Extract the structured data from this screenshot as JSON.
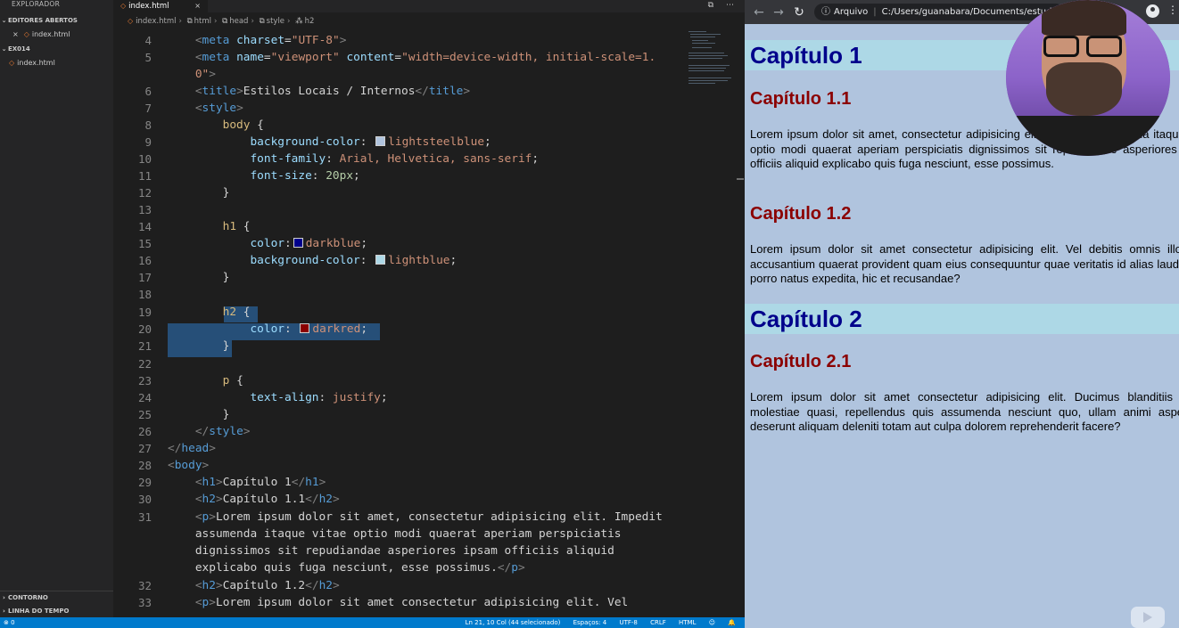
{
  "vscode": {
    "sidebar": {
      "title": "EXPLORADOR",
      "open_editors_label": "EDITORES ABERTOS",
      "open_editor_file": "index.html",
      "folder_label": "EX014",
      "folder_file": "index.html",
      "outline_label": "CONTORNO",
      "timeline_label": "LINHA DO TEMPO"
    },
    "tab": {
      "label": "index.html",
      "close": "×"
    },
    "tab_actions": [
      "⧉",
      "⋯"
    ],
    "breadcrumb": [
      "index.html",
      "html",
      "head",
      "style",
      "h2"
    ],
    "code_lines": [
      {
        "n": "4"
      },
      {
        "n": "5"
      },
      {
        "n": ""
      },
      {
        "n": "6"
      },
      {
        "n": "7"
      },
      {
        "n": "8"
      },
      {
        "n": "9"
      },
      {
        "n": "10"
      },
      {
        "n": "11"
      },
      {
        "n": "12"
      },
      {
        "n": "13"
      },
      {
        "n": "14"
      },
      {
        "n": "15"
      },
      {
        "n": "16"
      },
      {
        "n": "17"
      },
      {
        "n": "18"
      },
      {
        "n": "19"
      },
      {
        "n": "20"
      },
      {
        "n": "21"
      },
      {
        "n": "22"
      },
      {
        "n": "23"
      },
      {
        "n": "24"
      },
      {
        "n": "25"
      },
      {
        "n": "26"
      },
      {
        "n": "27"
      },
      {
        "n": "28"
      },
      {
        "n": "29"
      },
      {
        "n": "30"
      },
      {
        "n": "31"
      },
      {
        "n": ""
      },
      {
        "n": ""
      },
      {
        "n": ""
      },
      {
        "n": "32"
      },
      {
        "n": "33"
      }
    ],
    "code": {
      "meta_charset": "UTF-8",
      "meta_name": "viewport",
      "meta_content_1": "width=device-width, initial-scale=1.",
      "meta_content_2": "0",
      "title_text": "Estilos Locais / Internos",
      "body_bg": "lightsteelblue",
      "body_font": "Arial, Helvetica, sans-serif",
      "body_size": "20px",
      "h1_color": "darkblue",
      "h1_bg": "lightblue",
      "h2_color": "darkred",
      "p_align": "justify",
      "h1_text": "Capítulo 1",
      "h2_text": "Capítulo 1.1",
      "p_line1": "Lorem ipsum dolor sit amet, consectetur adipisicing elit. Impedit",
      "p_line2": "assumenda itaque vitae optio modi quaerat aperiam perspiciatis",
      "p_line3": "dignissimos sit repudiandae asperiores ipsam officiis aliquid",
      "p_line4": "explicabo quis fuga nesciunt, esse possimus.",
      "h2b_text": "Capítulo 1.2",
      "p2_line1": "Lorem ipsum dolor sit amet consectetur adipisicing elit. Vel"
    },
    "statusbar": {
      "left": "⊗ 0",
      "position": "Ln 21, 10 Col (44 selecionado)",
      "spaces": "Espaços: 4",
      "encoding": "UTF-8",
      "eol": "CRLF",
      "language": "HTML",
      "icons": [
        "☺",
        "🔔"
      ]
    }
  },
  "browser": {
    "back": "←",
    "forward": "→",
    "reload": "↻",
    "address_label": "Arquivo",
    "address_path": "C:/Users/guanabara/Documents/estudo",
    "menu": "⋮",
    "page": {
      "h1_1": "Capítulo 1",
      "h2_1": "Capítulo 1.1",
      "p1": "Lorem ipsum dolor sit amet, consectetur adipisicing elit. Impedit assumenda itaque vitae optio modi quaerat aperiam perspiciatis dignissimos sit repudiandae asperiores ipsam officiis aliquid explicabo quis fuga nesciunt, esse possimus.",
      "h2_2": "Capítulo 1.2",
      "p2": "Lorem ipsum dolor sit amet consectetur adipisicing elit. Vel debitis omnis illo sunt, accusantium quaerat provident quam eius consequuntur quae veritatis id alias laudantium porro natus expedita, hic et recusandae?",
      "h1_2": "Capítulo 2",
      "h2_3": "Capítulo 2.1",
      "p3": "Lorem ipsum dolor sit amet consectetur adipisicing elit. Ducimus blanditiis earum molestiae quasi, repellendus quis assumenda nesciunt quo, ullam animi aspernatur deserunt aliquam deleniti totam aut culpa dolorem reprehenderit facere?"
    }
  },
  "colors": {
    "editor_bg": "#1e1e1e",
    "statusbar": "#007acc",
    "page_bg": "#b0c4de",
    "h1_color": "#00008b",
    "h1_bg": "#add8e6",
    "h2_color": "#8b0000"
  }
}
